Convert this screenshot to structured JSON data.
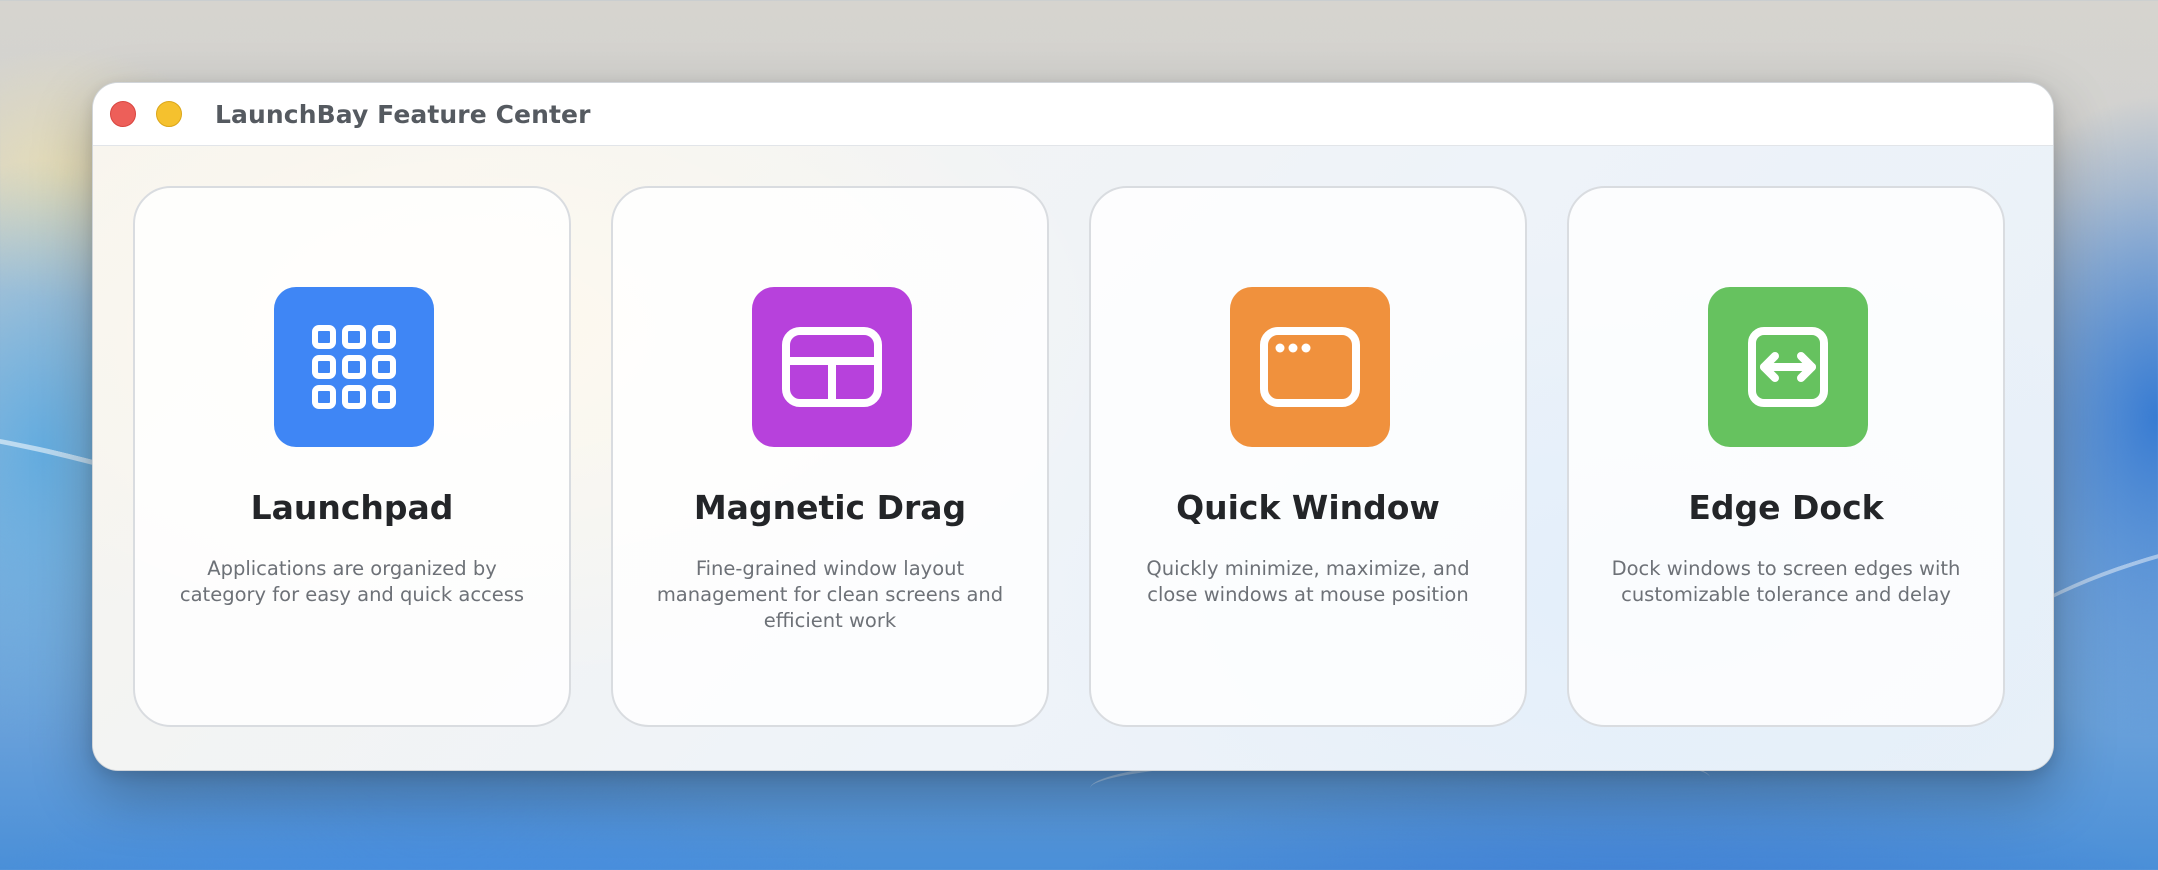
{
  "window": {
    "title": "LaunchBay Feature Center",
    "controls": [
      "close",
      "minimize"
    ]
  },
  "colors": {
    "close": "#ed5f59",
    "minimize": "#f5c12e",
    "launchpad": "#3f86f5",
    "magnetic_drag": "#b741dc",
    "quick_window": "#f0913d",
    "edge_dock": "#66c25f"
  },
  "features": [
    {
      "title": "Launchpad",
      "description": "Applications are organized by category for easy and quick access",
      "icon": "app-grid-icon",
      "color": "#3f86f5"
    },
    {
      "title": "Magnetic Drag",
      "description": "Fine-grained window layout management for clean screens and efficient work",
      "icon": "window-layout-icon",
      "color": "#b741dc"
    },
    {
      "title": "Quick Window",
      "description": "Quickly minimize, maximize, and close windows at mouse position",
      "icon": "app-window-icon",
      "color": "#f0913d"
    },
    {
      "title": "Edge Dock",
      "description": "Dock windows to screen edges with customizable tolerance and delay",
      "icon": "edge-arrows-icon",
      "color": "#66c25f"
    }
  ]
}
